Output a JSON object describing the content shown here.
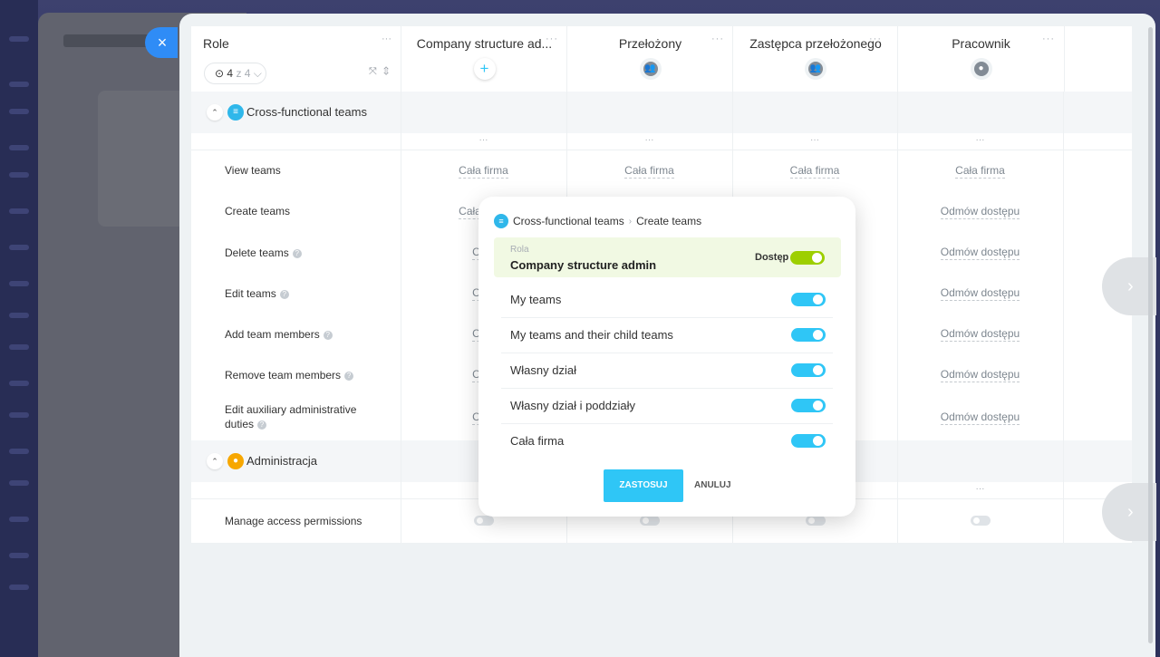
{
  "background": {
    "close_icon": "×"
  },
  "header": {
    "role_label": "Role",
    "role_counter": {
      "current": "4",
      "of_text": "z 4",
      "chevron": "⌵"
    },
    "sort_icons": "⤧ ⇕",
    "more": "···",
    "columns": [
      {
        "name": "Company structure ad...",
        "icon": "plus-icon",
        "glyph": "+"
      },
      {
        "name": "Przełożony",
        "icon": "group-icon",
        "glyph": "👥"
      },
      {
        "name": "Zastępca przełożonego",
        "icon": "group-icon",
        "glyph": "👥"
      },
      {
        "name": "Pracownik",
        "icon": "user-icon",
        "glyph": "●"
      }
    ]
  },
  "sections": [
    {
      "label": "Cross-functional teams",
      "icon_glyph": "≡",
      "icon_color": "#2fb7ea",
      "rows": [
        {
          "label": "View teams",
          "help": false,
          "cells": [
            "Cała firma",
            "Cała firma",
            "Cała firma",
            "Cała firma"
          ]
        },
        {
          "label": "Create teams",
          "help": false,
          "cells": [
            "Cała firma",
            "",
            "",
            "Odmów dostępu"
          ]
        },
        {
          "label": "Delete teams",
          "help": true,
          "cells": [
            "Cała",
            "",
            "",
            "Odmów dostępu"
          ]
        },
        {
          "label": "Edit teams",
          "help": true,
          "cells": [
            "Cała",
            "",
            "",
            "Odmów dostępu"
          ]
        },
        {
          "label": "Add team members",
          "help": true,
          "cells": [
            "Cała",
            "",
            "",
            "Odmów dostępu"
          ]
        },
        {
          "label": "Remove team members",
          "help": true,
          "cells": [
            "Cała",
            "",
            "",
            "Odmów dostępu"
          ]
        },
        {
          "label": "Edit auxiliary administrative duties",
          "help": true,
          "cells": [
            "Cała",
            "",
            "",
            "Odmów dostępu"
          ]
        }
      ]
    },
    {
      "label": "Administracja",
      "icon_glyph": "●",
      "icon_color": "#f7a700",
      "rows": [
        {
          "label": "Manage access permissions",
          "help": false,
          "cells": [
            "",
            "",
            "",
            ""
          ]
        }
      ]
    }
  ],
  "popup": {
    "breadcrumb_section": "Cross-functional teams",
    "breadcrumb_sep": "›",
    "breadcrumb_action": "Create teams",
    "role_caption": "Rola",
    "role_name": "Company structure admin",
    "access_label": "Dostęp",
    "access_on": true,
    "options": [
      {
        "label": "My teams",
        "on": true
      },
      {
        "label": "My teams and their child teams",
        "on": true
      },
      {
        "label": "Własny dział",
        "on": true
      },
      {
        "label": "Własny dział i poddziały",
        "on": true
      },
      {
        "label": "Cała firma",
        "on": true
      }
    ],
    "apply_label": "ZASTOSUJ",
    "cancel_label": "ANULUJ"
  },
  "nav": {
    "next_glyph": "›"
  },
  "colors": {
    "accent": "#2fc6f6",
    "access_green": "#9dcf00",
    "close_button": "#2f8cf6"
  }
}
